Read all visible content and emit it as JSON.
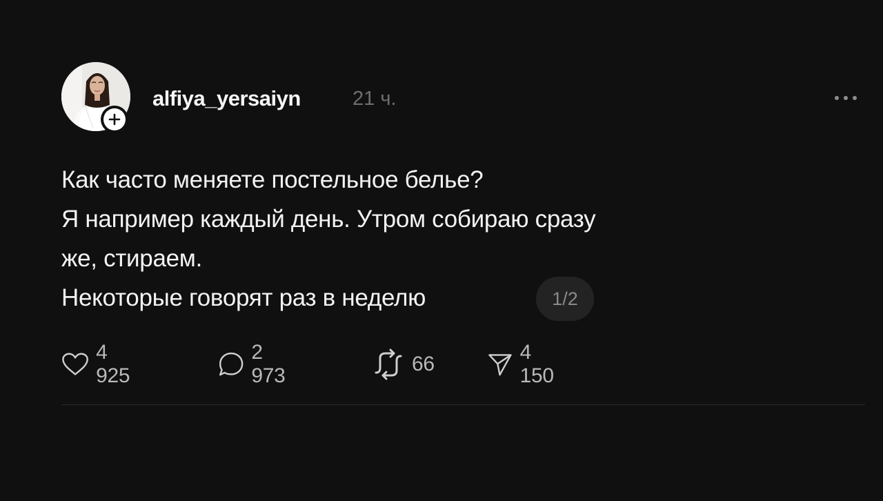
{
  "post": {
    "username": "alfiya_yersaiyn",
    "timestamp": "21 ч.",
    "text_lines": [
      "Как часто меняете постельное белье?",
      "Я например каждый день. Утром собираю сразу",
      "же, стираем.",
      "Некоторые говорят раз в неделю"
    ],
    "page_indicator": "1/2",
    "stats": {
      "likes": "4 925",
      "comments": "2 973",
      "reposts": "66",
      "shares": "4 150"
    }
  },
  "icons": {
    "follow": "plus-icon",
    "more": "more-dots-icon",
    "like": "heart-icon",
    "comment": "speech-bubble-icon",
    "repost": "repost-arrows-icon",
    "share": "paper-plane-icon"
  },
  "colors": {
    "background": "#101010",
    "text": "#f3f3f3",
    "muted": "#6e6e6e",
    "counts": "#b9b9b9"
  }
}
